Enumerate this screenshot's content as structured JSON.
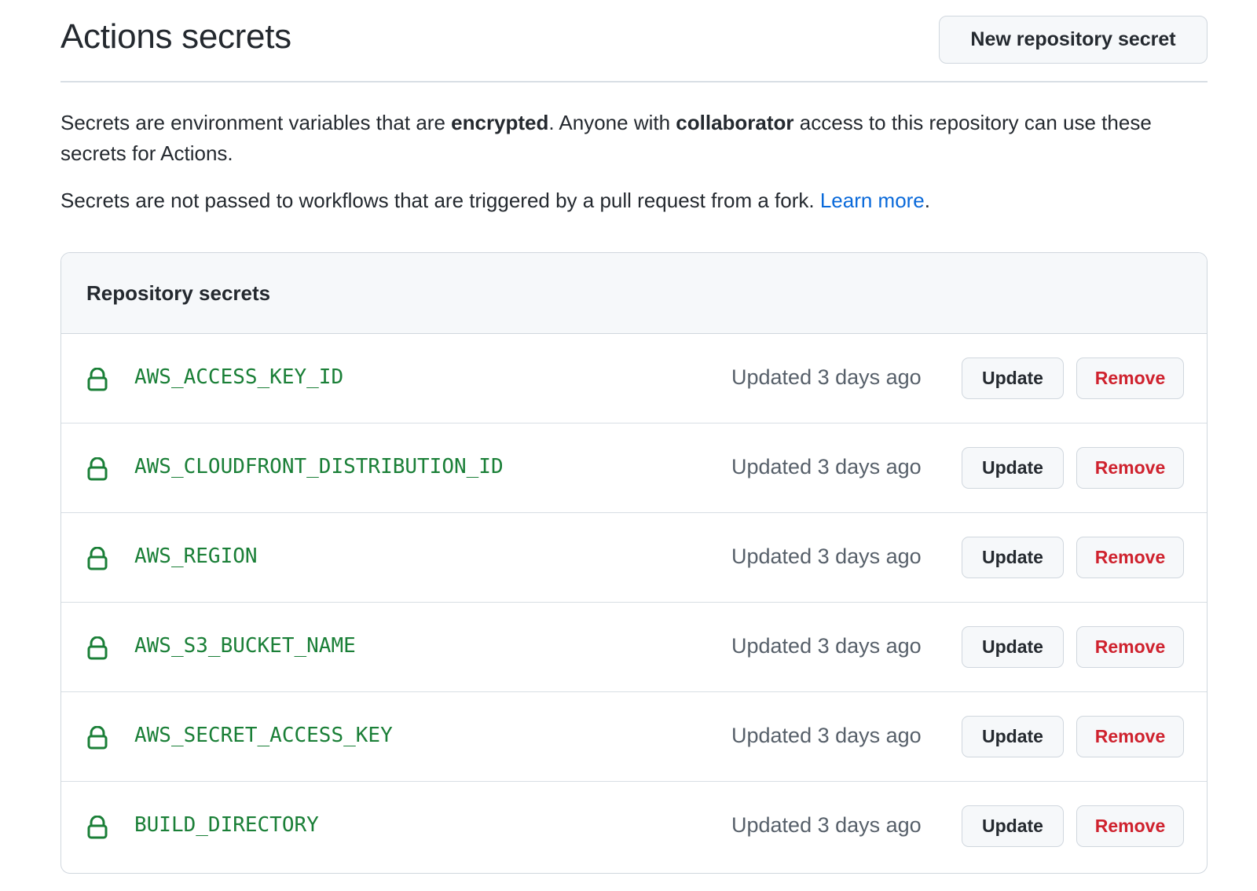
{
  "header": {
    "title": "Actions secrets",
    "new_secret_label": "New repository secret"
  },
  "description": {
    "p1_part1": "Secrets are environment variables that are ",
    "p1_bold1": "encrypted",
    "p1_part2": ". Anyone with ",
    "p1_bold2": "collaborator",
    "p1_part3": " access to this repository can use these secrets for Actions.",
    "p2_text": "Secrets are not passed to workflows that are triggered by a pull request from a fork. ",
    "p2_link": "Learn more",
    "p2_end": "."
  },
  "secrets_box": {
    "title": "Repository secrets",
    "update_label": "Update",
    "remove_label": "Remove",
    "rows": [
      {
        "name": "AWS_ACCESS_KEY_ID",
        "updated": "Updated 3 days ago"
      },
      {
        "name": "AWS_CLOUDFRONT_DISTRIBUTION_ID",
        "updated": "Updated 3 days ago"
      },
      {
        "name": "AWS_REGION",
        "updated": "Updated 3 days ago"
      },
      {
        "name": "AWS_S3_BUCKET_NAME",
        "updated": "Updated 3 days ago"
      },
      {
        "name": "AWS_SECRET_ACCESS_KEY",
        "updated": "Updated 3 days ago"
      },
      {
        "name": "BUILD_DIRECTORY",
        "updated": "Updated 3 days ago"
      }
    ]
  },
  "colors": {
    "secret_name": "#1a7f37",
    "link": "#0969da",
    "danger": "#cf222e",
    "muted": "#57606a"
  },
  "icons": {
    "row_icon": "lock-icon"
  }
}
